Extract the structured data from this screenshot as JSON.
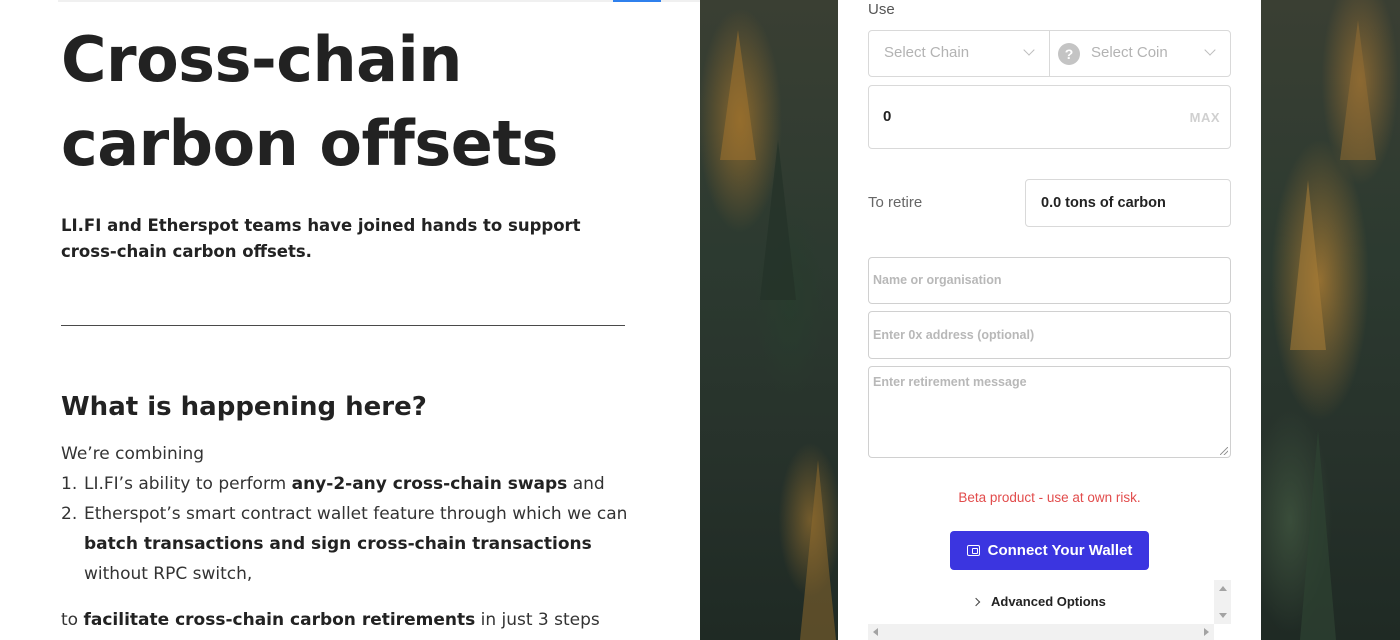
{
  "article": {
    "title_line1": "Cross-chain",
    "title_line2": "carbon offsets",
    "subtitle": "LI.FI and Etherspot teams have joined hands to support cross-chain carbon offsets.",
    "section_title": "What is happening here?",
    "intro": "We’re combining",
    "steps": [
      {
        "num": "1.",
        "before": "LI.FI’s ability to perform ",
        "bold": "any-2-any cross-chain swaps",
        "after": " and"
      },
      {
        "num": "2.",
        "before": "Etherspot’s smart contract wallet feature through which we can ",
        "bold": "batch transactions and sign cross-chain transactions",
        "after": " without RPC switch,"
      }
    ],
    "outro_before": "to ",
    "outro_bold": "facilitate cross-chain carbon retirements",
    "outro_after": " in just 3 steps"
  },
  "widget": {
    "use_label": "Use",
    "chain_select": "Select Chain",
    "coin_select": "Select Coin",
    "coin_icon_glyph": "?",
    "amount_value": "0",
    "max_label": "MAX",
    "retire_label": "To retire",
    "retire_value": "0.0 tons of carbon",
    "name_placeholder": "Name or organisation",
    "address_placeholder": "Enter 0x address (optional)",
    "message_placeholder": "Enter retirement message",
    "beta_notice": "Beta product - use at own risk.",
    "connect_button": "Connect Your Wallet",
    "advanced_options": "Advanced Options"
  },
  "colors": {
    "accent_button": "#3b35e0",
    "warning_text": "#e24c4c",
    "top_accent": "#2f80ed"
  },
  "icons": [
    "chevron-down-icon",
    "coin-unknown-icon",
    "wallet-icon",
    "chevron-right-icon",
    "scroll-arrow-icons",
    "resize-grip-icon"
  ]
}
